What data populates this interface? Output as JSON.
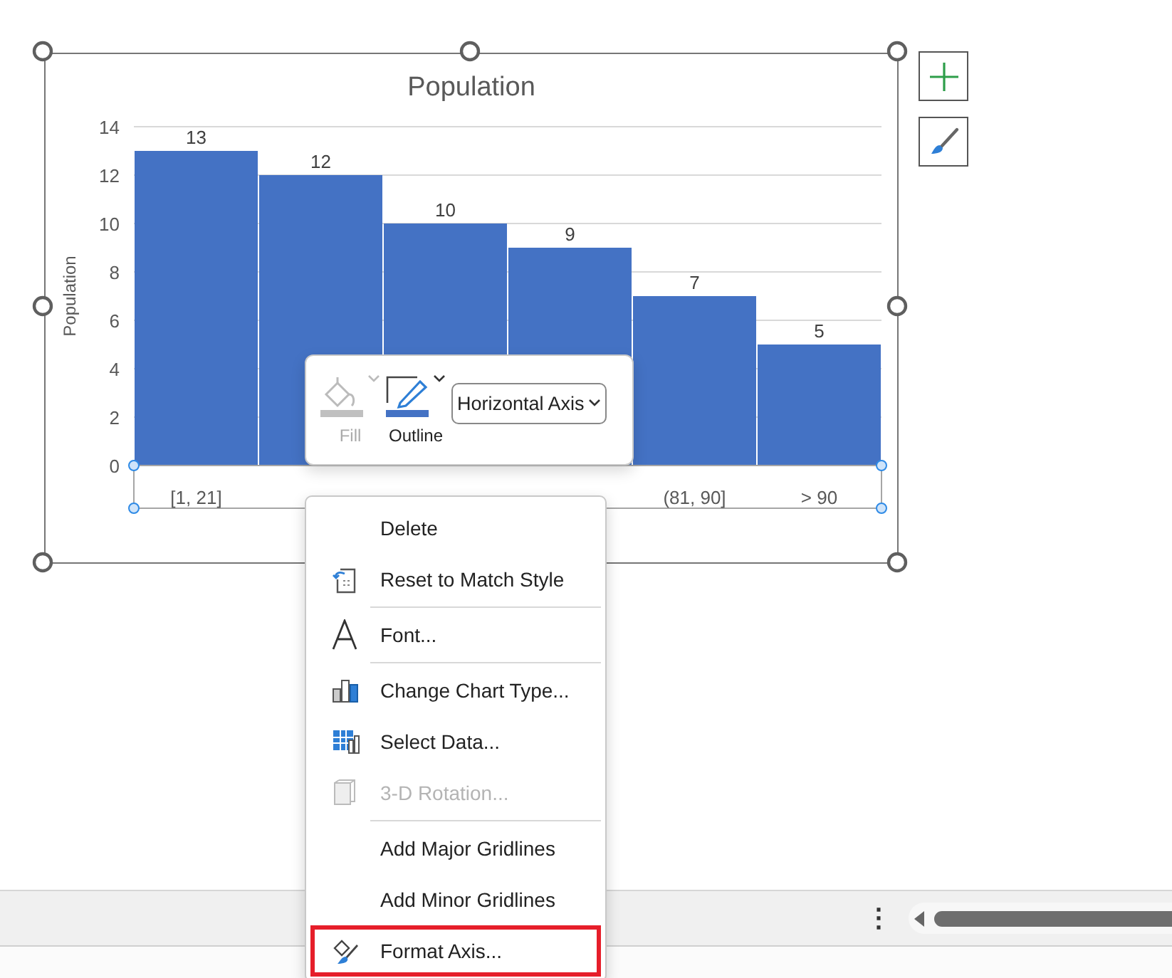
{
  "chart": {
    "chart_data": {
      "type": "bar",
      "title": "Population",
      "ylabel": "Population",
      "categories": [
        "[1, 21]",
        null,
        null,
        null,
        "(81, 90]",
        "> 90"
      ],
      "values": [
        13,
        12,
        10,
        9,
        7,
        5
      ],
      "ylim": [
        0,
        14
      ],
      "yticks": [
        0,
        2,
        4,
        6,
        8,
        10,
        12,
        14
      ],
      "grid": true,
      "data_labels": true
    },
    "side_buttons": [
      {
        "kind": "add"
      },
      {
        "kind": "style"
      }
    ]
  },
  "mini_toolbar": {
    "tools": [
      {
        "kind": "fill",
        "label": "Fill",
        "disabled": true
      },
      {
        "kind": "outline",
        "label": "Outline",
        "disabled": false
      }
    ],
    "element_select": {
      "value": "Horizontal Axis"
    }
  },
  "context_menu": {
    "items": [
      {
        "label": "Delete",
        "kind": "none",
        "disabled": false,
        "highlighted": false,
        "separator_before": false
      },
      {
        "label": "Reset to Match Style",
        "kind": "reset",
        "disabled": false,
        "highlighted": false,
        "separator_before": false
      },
      {
        "label": "Font...",
        "kind": "font",
        "disabled": false,
        "highlighted": false,
        "separator_before": true
      },
      {
        "label": "Change Chart Type...",
        "kind": "chart-type",
        "disabled": false,
        "highlighted": false,
        "separator_before": true
      },
      {
        "label": "Select Data...",
        "kind": "select-data",
        "disabled": false,
        "highlighted": false,
        "separator_before": false
      },
      {
        "label": "3-D Rotation...",
        "kind": "rotation",
        "disabled": true,
        "highlighted": false,
        "separator_before": false
      },
      {
        "label": "Add Major Gridlines",
        "kind": "none",
        "disabled": false,
        "highlighted": false,
        "separator_before": true
      },
      {
        "label": "Add Minor Gridlines",
        "kind": "none",
        "disabled": false,
        "highlighted": false,
        "separator_before": false
      },
      {
        "label": "Format Axis...",
        "kind": "format",
        "disabled": false,
        "highlighted": true,
        "separator_before": false
      }
    ]
  },
  "bottom_bar": {
    "more_glyph": "⋮"
  }
}
